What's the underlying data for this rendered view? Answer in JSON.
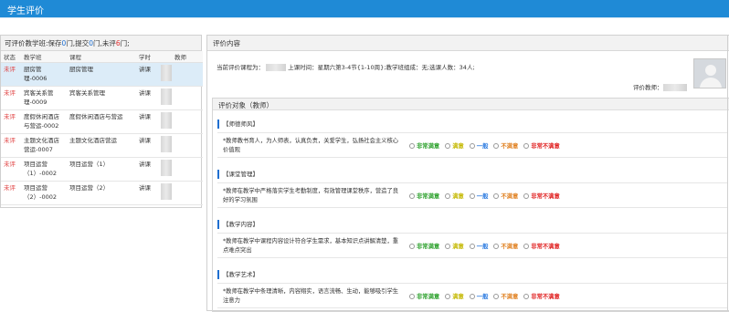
{
  "app": {
    "title": "学生评价"
  },
  "left_panel": {
    "summary_prefix": "可评价教学班:保存",
    "saved_count": "0",
    "summary_mid1": "门,提交",
    "submitted_count": "0",
    "summary_mid2": "门,未评",
    "unrated_count": "6",
    "summary_suffix": "门;",
    "columns": [
      "状态",
      "教学班",
      "课程",
      "学时",
      "教师"
    ],
    "rows": [
      {
        "status": "未评",
        "class": "厨房管理-0006",
        "course": "厨房管理",
        "hours": "讲课"
      },
      {
        "status": "未评",
        "class": "宾客关系管理-0009",
        "course": "宾客关系管理",
        "hours": "讲课"
      },
      {
        "status": "未评",
        "class": "度假休闲酒店与营运-0002",
        "course": "度假休闲酒店与营运",
        "hours": "讲课"
      },
      {
        "status": "未评",
        "class": "主题文化酒店营运-0007",
        "course": "主题文化酒店营运",
        "hours": "讲课"
      },
      {
        "status": "未评",
        "class": "项目运营（1）-0002",
        "course": "项目运营（1）",
        "hours": "讲课"
      },
      {
        "status": "未评",
        "class": "项目运营（2）-0002",
        "course": "项目运营（2）",
        "hours": "讲课"
      }
    ]
  },
  "right_panel": {
    "header": "评价内容",
    "info_prefix": "当前评价课程为：",
    "info_suffix": "上课时间：星期六第3-4节{1-10周};教学班组成：无;选课人数：34人;",
    "teacher_label": "评价教师：",
    "object_header": "评价对象（教师）",
    "options": [
      "非常满意",
      "满意",
      "一般",
      "不满意",
      "非常不满意"
    ],
    "sections": [
      {
        "title": "【师德师风】",
        "question": "*教师教书育人，为人师表，认真负责，关爱学生，弘扬社会主义核心价值观"
      },
      {
        "title": "【课堂管理】",
        "question": "*教师在教学中严格落实学生考勤制度，有效管理课堂秩序，营造了良好的学习氛围"
      },
      {
        "title": "【教学内容】",
        "question": "*教师在教学中课程内容设计符合学生需求，基本知识点讲解清楚，重点难点突出"
      },
      {
        "title": "【教学艺术】",
        "question": "*教师在教学中条理清晰，内容翔实，语言流畅、生动，能够吸引学生注意力"
      }
    ]
  }
}
